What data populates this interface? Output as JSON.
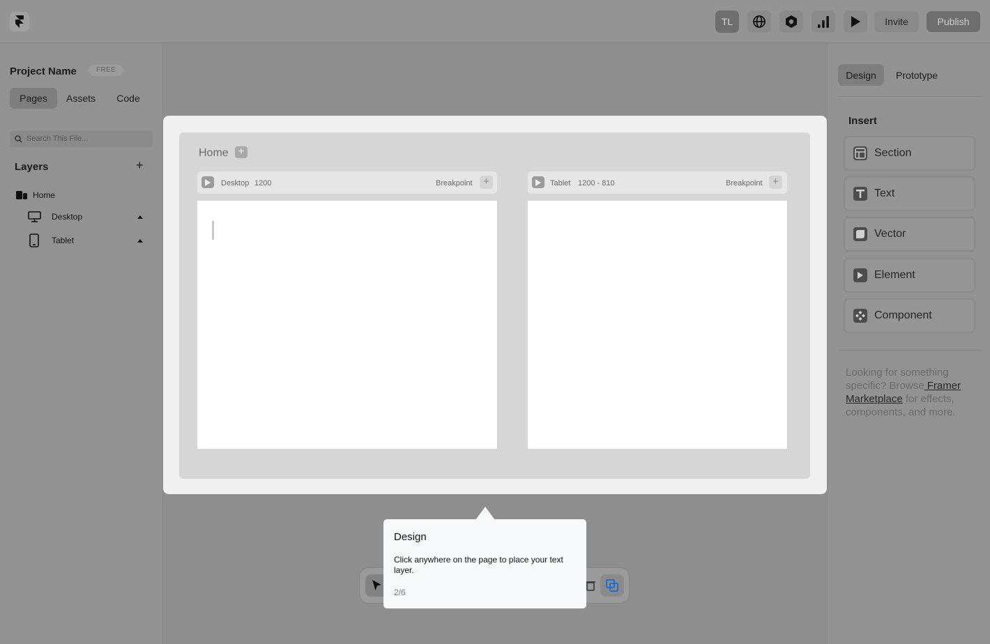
{
  "topbar": {
    "avatar_initials": "TL",
    "icons": [
      "framer-logo-icon",
      "globe-icon",
      "hexagon-icon",
      "chart-bars-icon",
      "play-icon"
    ],
    "invite_label": "Invite",
    "publish_label": "Publish"
  },
  "left": {
    "project_name": "Project Name",
    "plan_badge": "FREE",
    "tabs": [
      {
        "label": "Pages",
        "active": true
      },
      {
        "label": "Assets",
        "active": false
      },
      {
        "label": "Code",
        "active": false
      }
    ],
    "search_placeholder": "Search This File...",
    "layers_title": "Layers",
    "layers_add": "+",
    "layers": [
      {
        "label": "Home",
        "icon": "pages-icon"
      },
      {
        "label": "Desktop",
        "icon": "desktop-icon"
      },
      {
        "label": "Tablet",
        "icon": "tablet-icon"
      }
    ]
  },
  "canvas": {
    "page_label": "Home",
    "page_add": "+",
    "frames": [
      {
        "name": "Desktop",
        "size": "1200",
        "breakpoint_label": "Breakpoint",
        "add": "+"
      },
      {
        "name": "Tablet",
        "size": "1200 - 810",
        "breakpoint_label": "Breakpoint",
        "add": "+"
      }
    ]
  },
  "tooltip": {
    "title": "Design",
    "body": "Click anywhere on the page to place your text layer.",
    "step": "2/6"
  },
  "right": {
    "tabs": [
      {
        "label": "Design",
        "active": true
      },
      {
        "label": "Prototype",
        "active": false
      }
    ],
    "insert_title": "Insert",
    "insert_items": [
      {
        "label": "Section",
        "icon": "section-icon"
      },
      {
        "label": "Text",
        "icon": "text-icon"
      },
      {
        "label": "Vector",
        "icon": "vector-icon"
      },
      {
        "label": "Element",
        "icon": "element-icon"
      },
      {
        "label": "Component",
        "icon": "component-icon"
      }
    ],
    "help_prefix": "Looking for something specific? Browse",
    "help_link": " Framer Marketplace",
    "help_suffix": " for effects, components, and more."
  },
  "colors": {
    "overlay_bg": "#8e8e8e",
    "accent_blue": "#1f6fd6"
  }
}
